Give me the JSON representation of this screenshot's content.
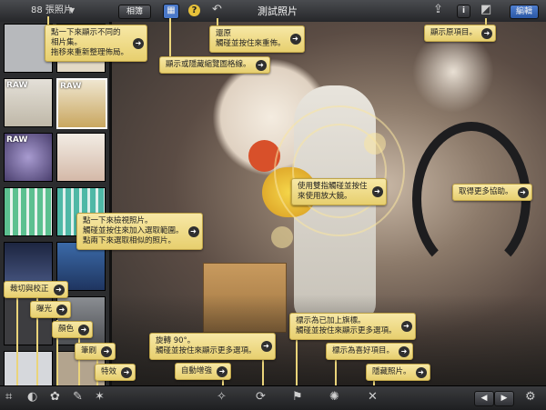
{
  "header": {
    "album_count": "88 張照片",
    "album_dropdown_icon": "triangle-down-icon",
    "browse_button": "相簿",
    "title": "測試照片",
    "edit_button": "編輯"
  },
  "callouts": {
    "albums": "點一下來顯示不同的\n相片集。\n拖移來重新整理佈局。",
    "grid": "顯示或隱藏縮覽圖格線。",
    "revert": "還原\n觸碰並按住來重佈。",
    "show_original": "顯示原項目。",
    "loupe": "使用雙指觸碰並按住\n來使用放大鏡。",
    "help": "取得更多協助。",
    "browse_photos": "點一下來檢視照片。\n觸碰並按住來加入選取範圍。\n點兩下來選取相似的照片。",
    "crop": "裁切與校正",
    "exposure": "曝光",
    "color": "顏色",
    "brushes": "筆刷",
    "effects": "特效",
    "rotate": "旋轉 90°。\n觸碰並按住來顯示更多選項。",
    "auto_enhance": "自動增強",
    "flag": "標示為已加上旗標。\n觸碰並按住來顯示更多選項。",
    "favorite": "標示為喜好項目。",
    "hide": "隱藏照片。"
  },
  "sidebar": {
    "thumbnails": [
      {
        "badge": "",
        "color": "#b7b9bc"
      },
      {
        "badge": "",
        "color": "#e3d9c6"
      },
      {
        "badge": "RAW",
        "color": "#cfcac0"
      },
      {
        "badge": "RAW",
        "color": "#d8cda8"
      },
      {
        "badge": "RAW",
        "color": "#8a7fb0"
      },
      {
        "badge": "",
        "color": "#e8dcd0"
      },
      {
        "badge": "",
        "color": "#4fb08a"
      },
      {
        "badge": "",
        "color": "#58c0b0"
      },
      {
        "badge": "",
        "color": "#2e3a55"
      },
      {
        "badge": "",
        "color": "#3f6b9c"
      },
      {
        "badge": "",
        "color": "#3d3d40"
      },
      {
        "badge": "",
        "color": "#6b6e73"
      },
      {
        "badge": "",
        "color": "#d6d8dc"
      },
      {
        "badge": "",
        "color": "#b3a48e"
      }
    ]
  },
  "colors": {
    "callout_bg": "#f0dc8a",
    "header_bg": "#3a3c40",
    "edit_button": "#2e5eaa",
    "grid_button": "#4a78c8"
  },
  "toolbar": {
    "left_icons": [
      "crop-icon",
      "exposure-icon",
      "color-icon",
      "brushes-icon",
      "effects-icon"
    ],
    "center_icons": [
      "auto-enhance-icon",
      "rotate-icon",
      "flag-icon",
      "favorite-icon",
      "hide-icon"
    ],
    "right_icons": [
      "previous-icon",
      "next-icon",
      "gear-icon"
    ]
  }
}
